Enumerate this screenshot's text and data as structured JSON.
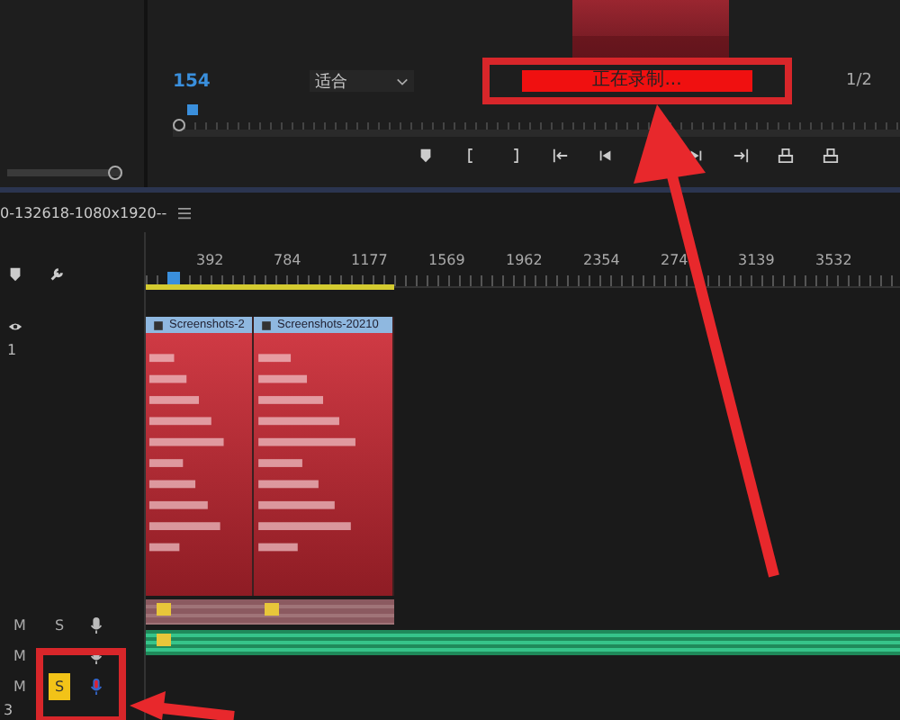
{
  "monitor": {
    "zoom_slider": {
      "level": 1
    },
    "timecode": "154",
    "zoom": "适合",
    "recording_label": "正在录制...",
    "resolution": "1/2"
  },
  "timeline": {
    "sequence_title": "0-132618-1080x1920--",
    "ruler": [
      "392",
      "784",
      "1177",
      "1569",
      "1962",
      "2354",
      "274",
      "3139",
      "3532"
    ],
    "video_track": {
      "label": "1",
      "clips": [
        {
          "title": "Screenshots-2"
        },
        {
          "title": "Screenshots-20210"
        }
      ]
    },
    "audio_tracks": [
      {
        "mute": "M",
        "solo": "S",
        "solo_on": false,
        "record_armed": false
      },
      {
        "mute": "M",
        "record_armed": false
      },
      {
        "mute": "M",
        "solo": "S",
        "solo_on": true,
        "record_armed": true
      }
    ],
    "bottom_label": "3"
  }
}
